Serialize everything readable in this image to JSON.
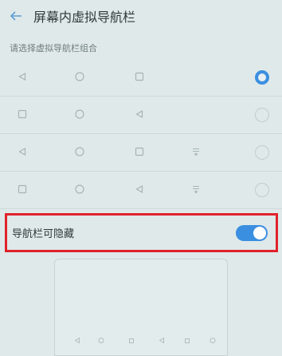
{
  "header": {
    "back_icon": "back-arrow-icon",
    "title": "屏幕内虚拟导航栏"
  },
  "section_label": "请选择虚拟导航栏组合",
  "nav_options": [
    {
      "icons": [
        "back-triangle-icon",
        "home-circle-icon",
        "recent-square-icon"
      ],
      "selected": true
    },
    {
      "icons": [
        "recent-square-icon",
        "home-circle-icon",
        "back-triangle-icon"
      ],
      "selected": false
    },
    {
      "icons": [
        "back-triangle-icon",
        "home-circle-icon",
        "recent-square-icon",
        "notification-pulldown-icon"
      ],
      "selected": false
    },
    {
      "icons": [
        "recent-square-icon",
        "home-circle-icon",
        "back-triangle-icon",
        "notification-pulldown-icon"
      ],
      "selected": false
    }
  ],
  "hide_option": {
    "label": "导航栏可隐藏",
    "enabled": true
  },
  "colors": {
    "accent": "#3b8fe0",
    "highlight_border": "#e0232b",
    "background": "#dfe9ea"
  }
}
